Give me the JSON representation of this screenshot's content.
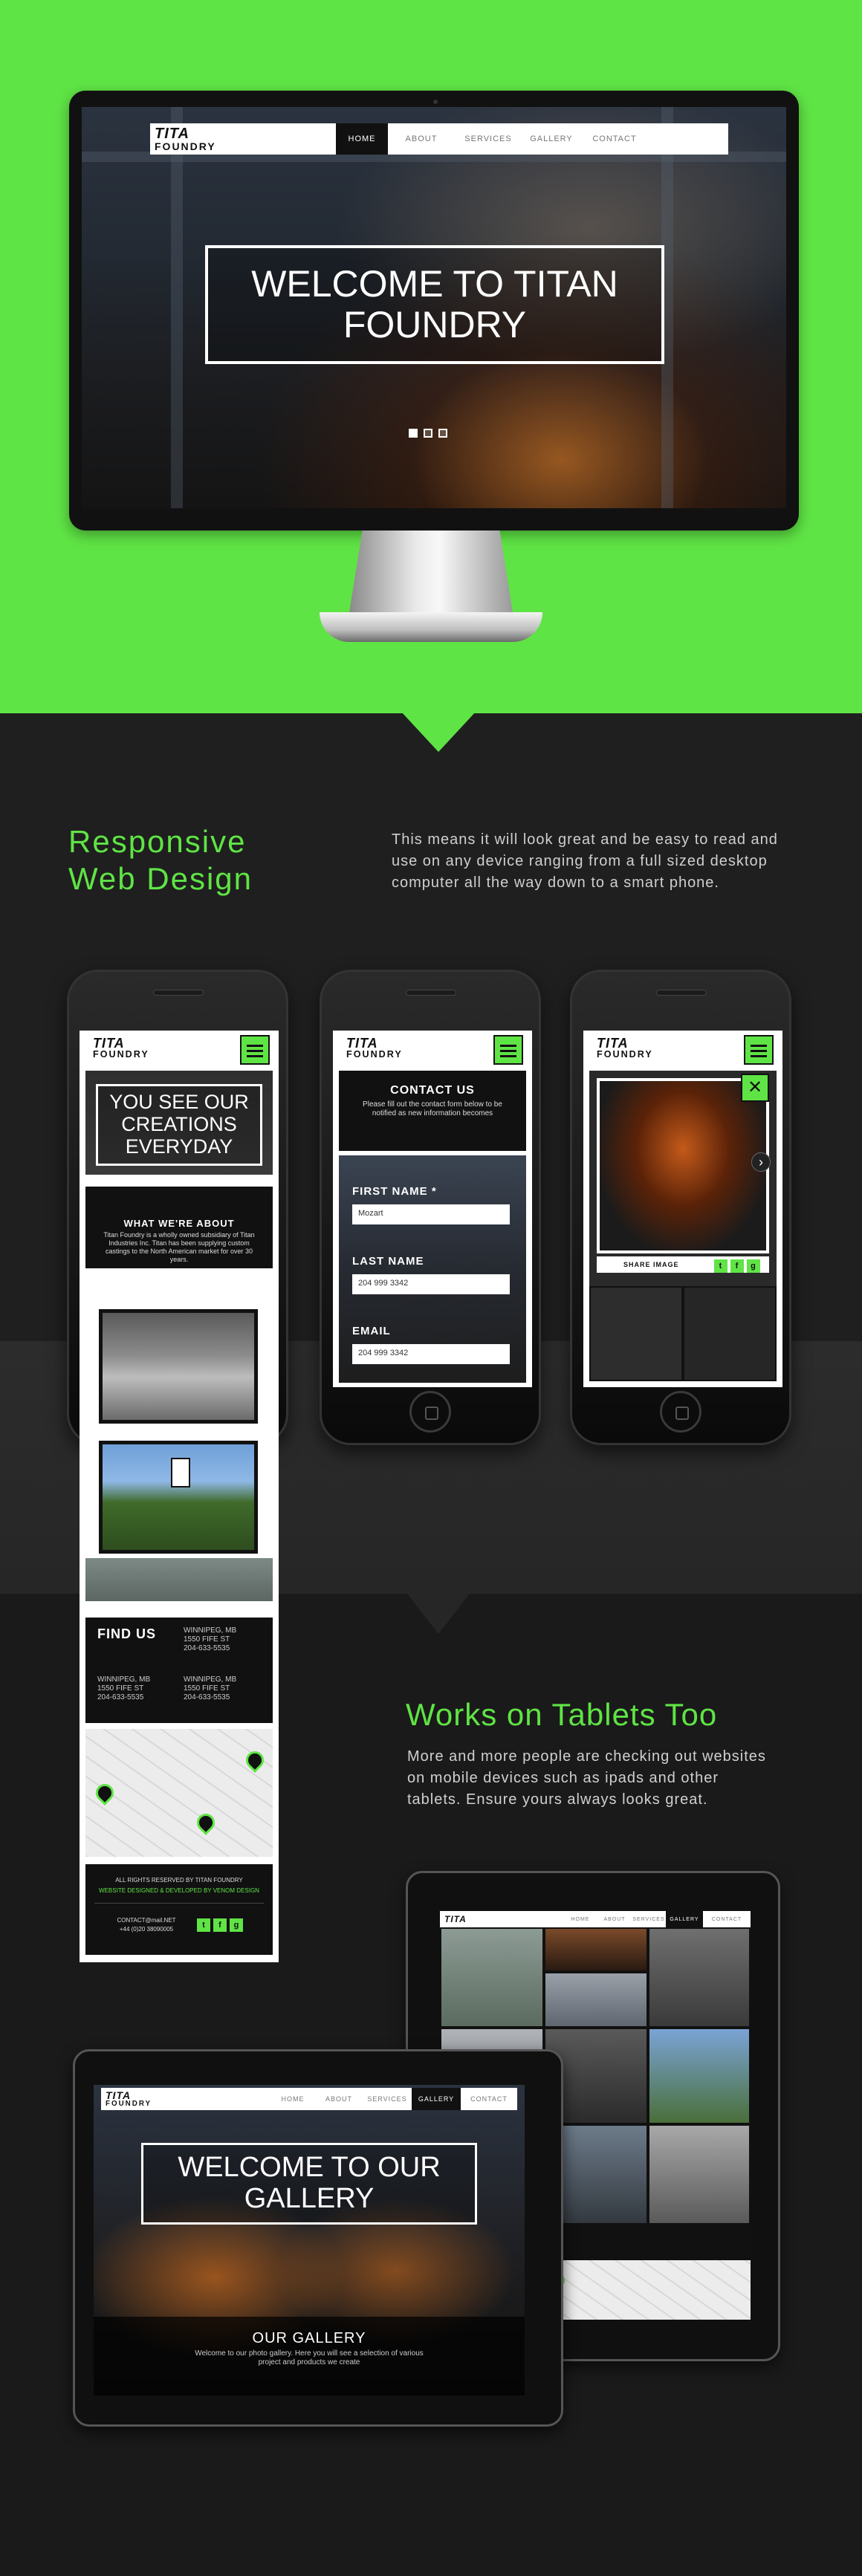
{
  "colors": {
    "accent": "#5fe445",
    "background": "#1f1f1f",
    "dark": "#111111"
  },
  "desktop": {
    "logo_line1": "TITA",
    "logo_line2": "FOUNDRY",
    "nav": [
      "HOME",
      "ABOUT",
      "SERVICES",
      "GALLERY",
      "CONTACT"
    ],
    "active_nav": "HOME",
    "hero_title": "WELCOME TO TITAN FOUNDRY",
    "slides": 3
  },
  "responsive": {
    "heading_line1": "Responsive",
    "heading_line2": "Web Design",
    "description": "This means it will look great and be easy to read and use on any device ranging from a full sized desktop computer all the way down to a smart phone."
  },
  "phone1": {
    "logo_line1": "TITA",
    "logo_line2": "FOUNDRY",
    "hero": "YOU SEE OUR CREATIONS EVERYDAY",
    "about_title": "WHAT WE'RE ABOUT",
    "about_text": "Titan Foundry is a wholly owned subsidiary of Titan Industries Inc. Titan has been supplying custom castings to the North American market for over 30 years.",
    "find_us": "FIND US",
    "locations": [
      {
        "city": "WINNIPEG, MB",
        "street": "1550 FIFE ST",
        "phone": "204-633-5535"
      },
      {
        "city": "WINNIPEG, MB",
        "street": "1550 FIFE ST",
        "phone": "204-633-5535"
      },
      {
        "city": "WINNIPEG, MB",
        "street": "1550 FIFE ST",
        "phone": "204-633-5535"
      }
    ],
    "footer_rights": "ALL RIGHTS RESERVED BY TITAN FOUNDRY",
    "footer_credit": "WEBSITE DESIGNED & DEVELOPED BY VENOM DESIGN",
    "footer_contact": "CONTACT@mail.NET",
    "footer_phone": "+44 (0)20 38090005"
  },
  "phone2": {
    "logo_line1": "TITA",
    "logo_line2": "FOUNDRY",
    "contact_title": "CONTACT US",
    "contact_text": "Please fill out the contact form below to be notified as new information becomes",
    "first_name_label": "FIRST NAME *",
    "first_name_value": "Mozart",
    "last_name_label": "LAST NAME",
    "last_name_value": "204 999 3342",
    "email_label": "EMAIL",
    "email_value": "204 999 3342"
  },
  "phone3": {
    "logo_line1": "TITA",
    "logo_line2": "FOUNDRY",
    "close": "✕",
    "next": "›",
    "share_label": "SHARE IMAGE"
  },
  "tablets": {
    "heading": "Works on Tablets Too",
    "description": "More and more people are checking out websites on mobile devices such as ipads and other tablets. Ensure yours always looks great."
  },
  "tablet_back": {
    "logo_line1": "TITA",
    "nav": [
      "HOME",
      "ABOUT",
      "SERVICES",
      "GALLERY",
      "CONTACT"
    ]
  },
  "tablet_front": {
    "logo_line1": "TITA",
    "logo_line2": "FOUNDRY",
    "nav": [
      "HOME",
      "ABOUT",
      "SERVICES",
      "GALLERY",
      "CONTACT"
    ],
    "active_nav": "GALLERY",
    "hero_title": "WELCOME TO OUR GALLERY",
    "gallery_title": "OUR GALLERY",
    "gallery_text": "Welcome to our photo gallery. Here you will see a selection of various project and products we create"
  }
}
